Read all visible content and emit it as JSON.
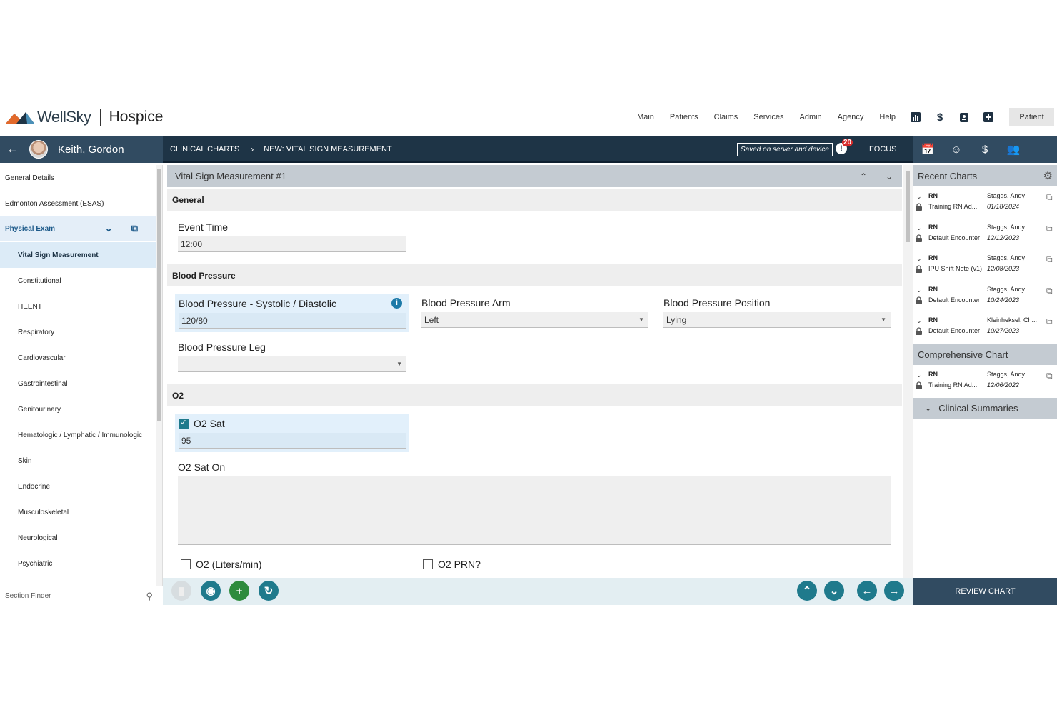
{
  "app": {
    "brand": "WellSky",
    "product": "Hospice"
  },
  "topnav": {
    "links": [
      "Main",
      "Patients",
      "Claims",
      "Services",
      "Admin",
      "Agency",
      "Help"
    ],
    "patient_button": "Patient"
  },
  "patient": {
    "name": "Keith, Gordon"
  },
  "breadcrumb": {
    "root": "CLINICAL CHARTS",
    "current": "NEW: VITAL SIGN MEASUREMENT"
  },
  "status": {
    "saved": "Saved on server and device",
    "alerts_count": "20",
    "focus": "FOCUS"
  },
  "sidebar": {
    "items": [
      "General Details",
      "Edmonton Assessment (ESAS)"
    ],
    "group": "Physical Exam",
    "children": [
      "Vital Sign Measurement",
      "Constitutional",
      "HEENT",
      "Respiratory",
      "Cardiovascular",
      "Gastrointestinal",
      "Genitourinary",
      "Hematologic / Lymphatic / Immunologic",
      "Skin",
      "Endocrine",
      "Musculoskeletal",
      "Neurological",
      "Psychiatric"
    ],
    "finder_label": "Section Finder"
  },
  "form": {
    "title": "Vital Sign Measurement #1",
    "sections": {
      "general": "General",
      "bp": "Blood Pressure",
      "o2": "O2"
    },
    "event_time": {
      "label": "Event Time",
      "value": "12:00"
    },
    "bp_sd": {
      "label": "Blood Pressure - Systolic / Diastolic",
      "value": "120/80"
    },
    "bp_arm": {
      "label": "Blood Pressure Arm",
      "value": "Left"
    },
    "bp_position": {
      "label": "Blood Pressure Position",
      "value": "Lying"
    },
    "bp_leg": {
      "label": "Blood Pressure Leg",
      "value": ""
    },
    "o2_sat": {
      "label": "O2 Sat",
      "value": "95",
      "checked": true
    },
    "o2_sat_on": {
      "label": "O2 Sat On",
      "value": ""
    },
    "o2_liters": {
      "label": "O2 (Liters/min)",
      "checked": false
    },
    "o2_prn": {
      "label": "O2 PRN?",
      "checked": false
    }
  },
  "recent": {
    "title": "Recent Charts",
    "charts": [
      {
        "type": "RN",
        "name": "Training RN Ad...",
        "author": "Staggs, Andy",
        "date": "01/18/2024"
      },
      {
        "type": "RN",
        "name": "Default Encounter",
        "author": "Staggs, Andy",
        "date": "12/12/2023"
      },
      {
        "type": "RN",
        "name": "IPU Shift Note (v1)",
        "author": "Staggs, Andy",
        "date": "12/08/2023"
      },
      {
        "type": "RN",
        "name": "Default Encounter",
        "author": "Staggs, Andy",
        "date": "10/24/2023"
      },
      {
        "type": "RN",
        "name": "Default Encounter",
        "author": "Kleinheksel, Ch...",
        "date": "10/27/2023"
      }
    ],
    "comprehensive_title": "Comprehensive Chart",
    "comprehensive": {
      "type": "RN",
      "name": "Training RN Ad...",
      "author": "Staggs, Andy",
      "date": "12/06/2022"
    },
    "summaries_title": "Clinical Summaries",
    "review_button": "REVIEW CHART"
  },
  "colors": {
    "dark": "#1e3446",
    "teal": "#1f7a8c",
    "green": "#2e8b3d"
  }
}
